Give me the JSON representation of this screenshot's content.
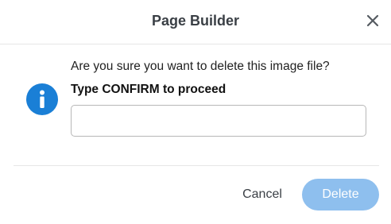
{
  "dialog": {
    "title": "Page Builder",
    "question": "Are you sure you want to delete this image file?",
    "instruction": "Type CONFIRM to proceed",
    "input": {
      "value": "",
      "placeholder": ""
    },
    "buttons": {
      "cancel_label": "Cancel",
      "delete_label": "Delete",
      "delete_enabled": false
    },
    "icons": {
      "close": "close-icon",
      "info": "info-icon"
    },
    "colors": {
      "accent": "#1a7fd6",
      "delete_disabled": "#8ebfee",
      "title": "#3a3f45"
    }
  }
}
